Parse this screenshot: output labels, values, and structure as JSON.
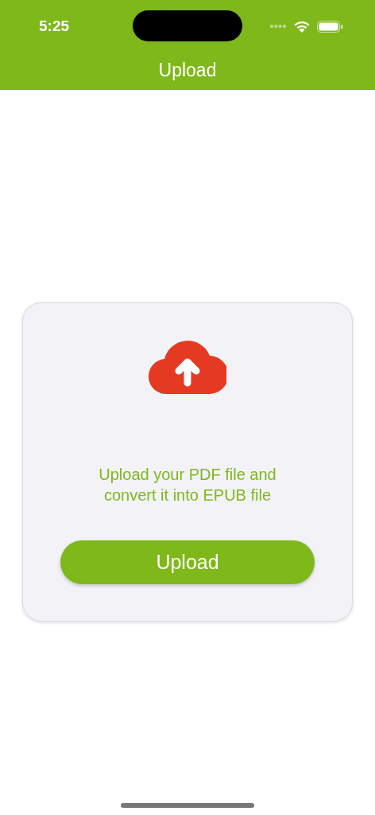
{
  "status_bar": {
    "time": "5:25"
  },
  "nav_bar": {
    "title": "Upload"
  },
  "upload_card": {
    "message": "Upload your PDF file and convert it into EPUB file",
    "button": "Upload"
  }
}
